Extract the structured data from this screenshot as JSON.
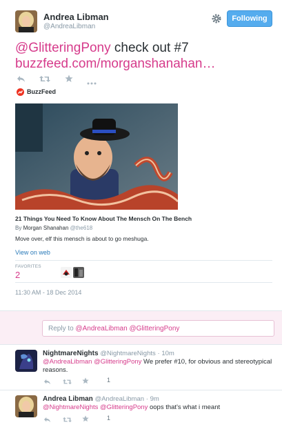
{
  "main_tweet": {
    "author_name": "Andrea Libman",
    "author_handle": "@AndreaLibman",
    "follow_label": "Following",
    "text_mention": "@GlitteringPony",
    "text_body": " check out #7",
    "text_link": "buzzfeed.com/morganshanahan…",
    "source_name": "BuzzFeed",
    "card": {
      "title": "21 Things You Need To Know About The Mensch On The Bench",
      "byline_prefix": "By",
      "byline_author": "Morgan Shanahan",
      "byline_handle": "@the618",
      "description": "Move over, elf this mensch is about to go meshuga.",
      "view_link": "View on web"
    },
    "stats": {
      "favorites_label": "FAVORITES",
      "favorites_count": "2"
    },
    "timestamp": "11:30 AM - 18 Dec 2014"
  },
  "reply_box": {
    "prefix": "Reply to ",
    "handles": "@AndreaLibman @GlitteringPony"
  },
  "replies": [
    {
      "author_name": "NightmareNights",
      "author_handle": "@NightmareNights",
      "time": "· 10m",
      "mentions": "@AndreaLibman @GlitteringPony",
      "text": " We prefer #10, for obvious and stereotypical reasons.",
      "fav_count": "1"
    },
    {
      "author_name": "Andrea Libman",
      "author_handle": "@AndreaLibman",
      "time": "· 9m",
      "mentions": "@NightmareNights @GlitteringPony",
      "text": " oops that's what i meant",
      "fav_count": "1"
    }
  ],
  "colors": {
    "accent_pink": "#d63b8b",
    "follow_blue": "#55acee",
    "link_blue": "#2b7bb9",
    "reply_panel_bg": "#fbeef5"
  },
  "icons": [
    "reply-icon",
    "retweet-icon",
    "favorite-icon",
    "more-icon",
    "gear-icon",
    "buzzfeed-logo-icon"
  ]
}
